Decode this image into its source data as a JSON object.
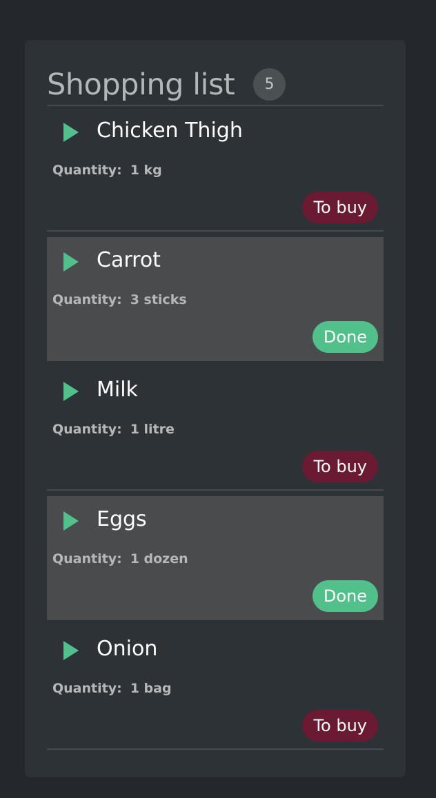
{
  "header": {
    "title": "Shopping list",
    "count": "5"
  },
  "quantity_label": "Quantity:",
  "items": [
    {
      "name": "Chicken Thigh",
      "quantity": "1 kg",
      "status": "To buy",
      "done": false
    },
    {
      "name": "Carrot",
      "quantity": "3 sticks",
      "status": "Done",
      "done": true
    },
    {
      "name": "Milk",
      "quantity": "1 litre",
      "status": "To buy",
      "done": false
    },
    {
      "name": "Eggs",
      "quantity": "1 dozen",
      "status": "Done",
      "done": true
    },
    {
      "name": "Onion",
      "quantity": "1 bag",
      "status": "To buy",
      "done": false
    }
  ],
  "colors": {
    "background": "#24282c",
    "panel": "#2d3236",
    "done_row": "#4a4b4c",
    "accent_green": "#52c08a",
    "to_buy": "#6a1a32"
  }
}
